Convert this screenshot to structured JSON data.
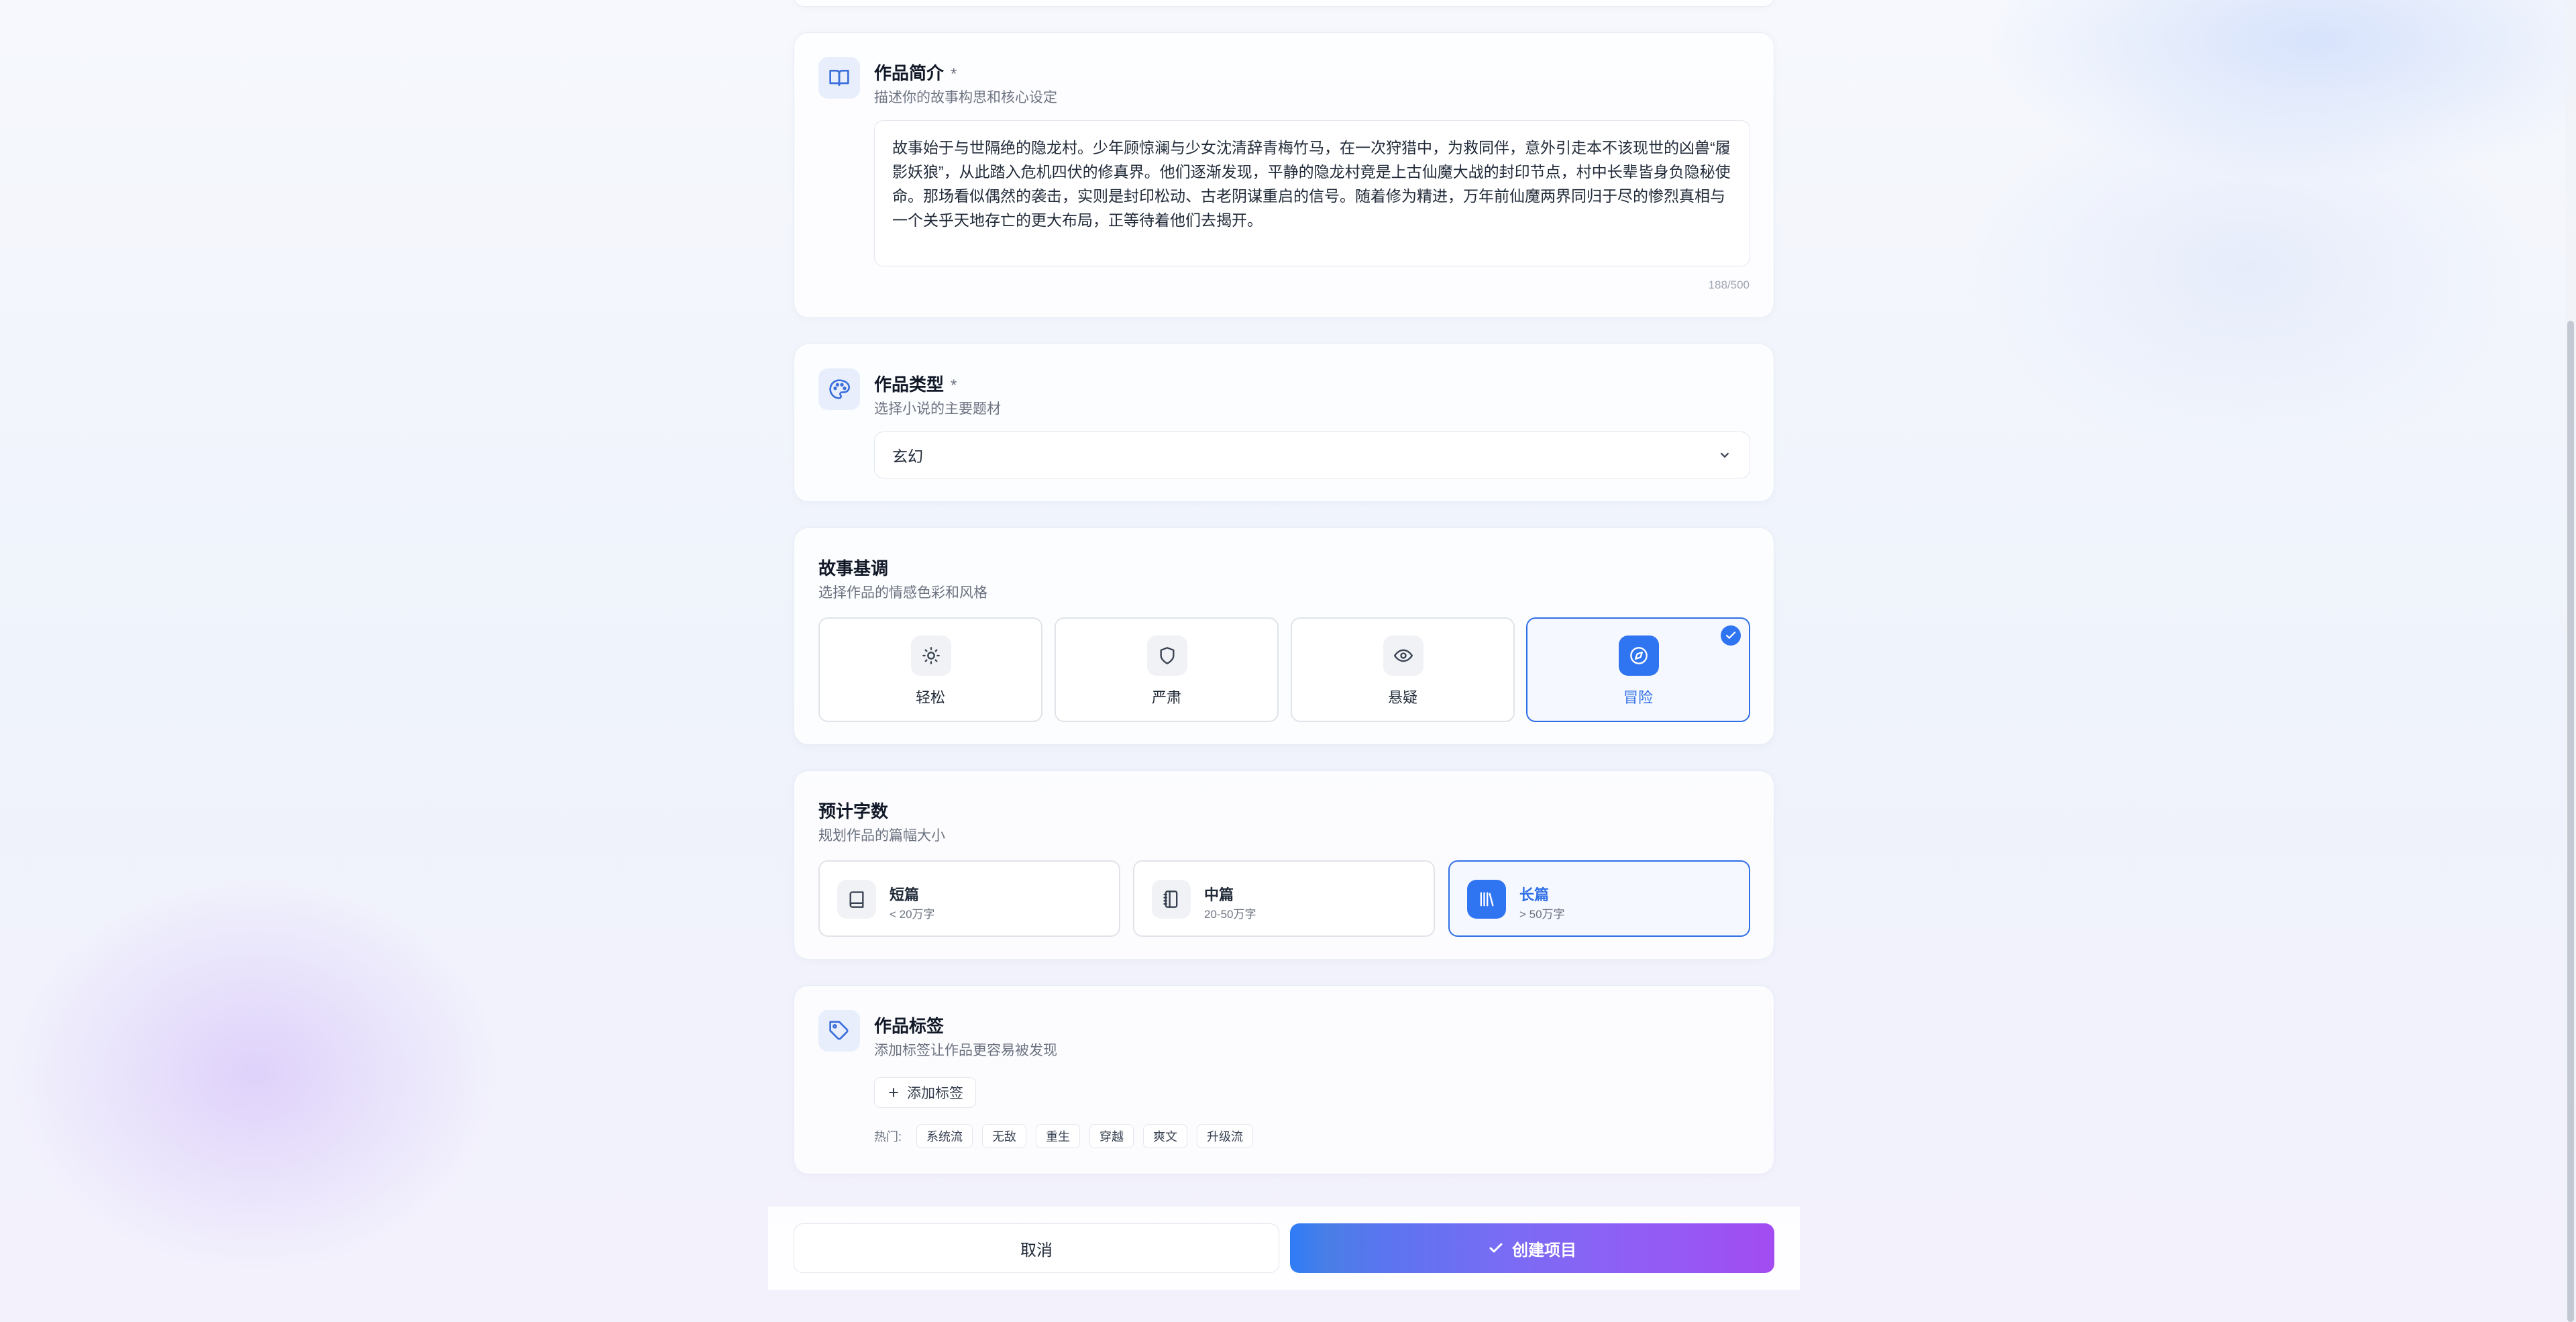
{
  "intro": {
    "title": "作品简介",
    "required_mark": "*",
    "subtitle": "描述你的故事构思和核心设定",
    "value": "故事始于与世隔绝的隐龙村。少年顾惊澜与少女沈清辞青梅竹马，在一次狩猎中，为救同伴，意外引走本不该现世的凶兽“履影妖狼”，从此踏入危机四伏的修真界。他们逐渐发现，平静的隐龙村竟是上古仙魔大战的封印节点，村中长辈皆身负隐秘使命。那场看似偶然的袭击，实则是封印松动、古老阴谋重启的信号。随着修为精进，万年前仙魔两界同归于尽的惨烈真相与一个关乎天地存亡的更大布局，正等待着他们去揭开。",
    "counter": "188/500",
    "icon": "book-open-icon"
  },
  "genre": {
    "title": "作品类型",
    "required_mark": "*",
    "subtitle": "选择小说的主要题材",
    "selected": "玄幻",
    "icon": "palette-icon"
  },
  "tone": {
    "title": "故事基调",
    "subtitle": "选择作品的情感色彩和风格",
    "options": [
      {
        "label": "轻松",
        "icon": "sun-icon",
        "selected": false
      },
      {
        "label": "严肃",
        "icon": "shield-icon",
        "selected": false
      },
      {
        "label": "悬疑",
        "icon": "eye-icon",
        "selected": false
      },
      {
        "label": "冒险",
        "icon": "compass-icon",
        "selected": true
      }
    ]
  },
  "length": {
    "title": "预计字数",
    "subtitle": "规划作品的篇幅大小",
    "options": [
      {
        "name": "短篇",
        "desc": "< 20万字",
        "icon": "book-icon",
        "selected": false
      },
      {
        "name": "中篇",
        "desc": "20-50万字",
        "icon": "notebook-icon",
        "selected": false
      },
      {
        "name": "长篇",
        "desc": "> 50万字",
        "icon": "library-icon",
        "selected": true
      }
    ]
  },
  "tags": {
    "title": "作品标签",
    "subtitle": "添加标签让作品更容易被发现",
    "add_label": "添加标签",
    "hot_label": "热门:",
    "hot": [
      "系统流",
      "无敌",
      "重生",
      "穿越",
      "爽文",
      "升级流"
    ],
    "icon": "tag-icon"
  },
  "actions": {
    "cancel": "取消",
    "create": "创建项目"
  },
  "colors": {
    "accent": "#2f74f0",
    "gradient_end": "#a24cf2"
  }
}
